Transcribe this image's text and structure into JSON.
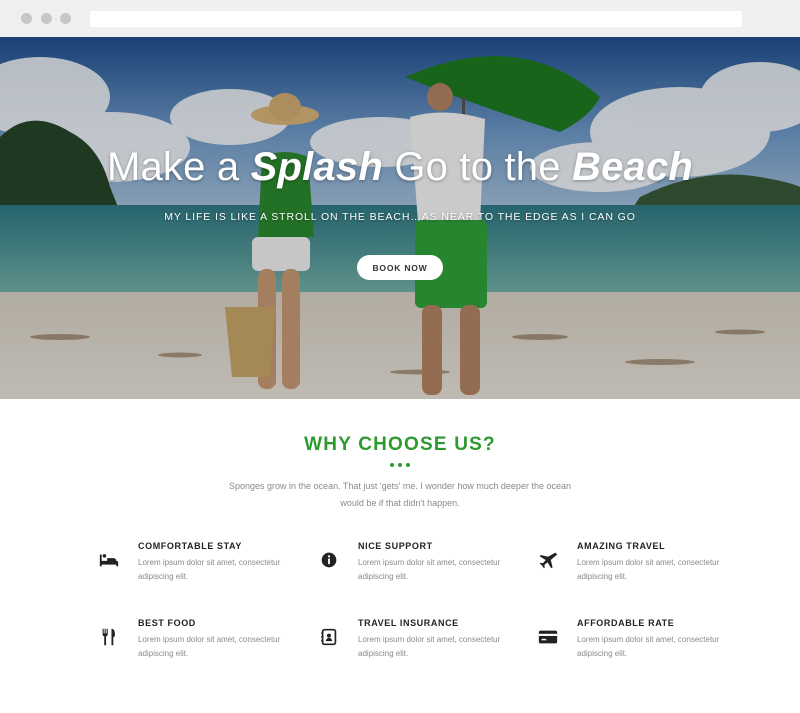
{
  "hero": {
    "title_part1": "Make a ",
    "title_em1": "Splash",
    "title_part2": " Go to the ",
    "title_em2": "Beach",
    "subtitle": "MY LIFE IS LIKE A STROLL ON THE BEACH…AS NEAR TO THE EDGE AS I CAN GO",
    "button_label": "BOOK NOW"
  },
  "why": {
    "title": "WHY CHOOSE US?",
    "description": "Sponges grow in the ocean. That just 'gets' me. I wonder how much deeper the ocean would be if that didn't happen."
  },
  "features": [
    {
      "title": "COMFORTABLE STAY",
      "description": "Lorem ipsum dolor sit amet, consectetur adipiscing elit.",
      "icon": "bed-icon"
    },
    {
      "title": "NICE SUPPORT",
      "description": "Lorem ipsum dolor sit amet, consectetur adipiscing elit.",
      "icon": "info-icon"
    },
    {
      "title": "AMAZING TRAVEL",
      "description": "Lorem ipsum dolor sit amet, consectetur adipiscing elit.",
      "icon": "airplane-icon"
    },
    {
      "title": "BEST FOOD",
      "description": "Lorem ipsum dolor sit amet, consectetur adipiscing elit.",
      "icon": "utensils-icon"
    },
    {
      "title": "TRAVEL INSURANCE",
      "description": "Lorem ipsum dolor sit amet, consectetur adipiscing elit.",
      "icon": "contact-book-icon"
    },
    {
      "title": "AFFORDABLE RATE",
      "description": "Lorem ipsum dolor sit amet, consectetur adipiscing elit.",
      "icon": "credit-card-icon"
    }
  ],
  "colors": {
    "accent": "#2d9a2f",
    "text_dark": "#222222",
    "text_muted": "#8a8a8a"
  }
}
